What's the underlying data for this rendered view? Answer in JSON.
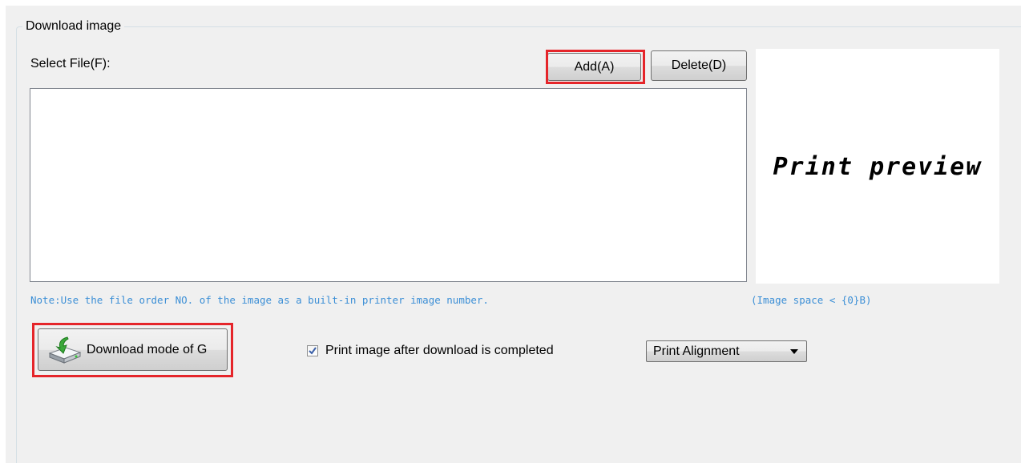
{
  "group": {
    "title": "Download image"
  },
  "file_select": {
    "label": "Select File(F):",
    "add_label": "Add(A)",
    "delete_label": "Delete(D)",
    "items": []
  },
  "preview": {
    "text": "Print preview",
    "image_space": "(Image space < {0}B)"
  },
  "note": "Note:Use the file order NO. of the image as a built-in printer image number.",
  "download": {
    "button_label": "Download mode of G",
    "icon": "download-drive-icon"
  },
  "print_after": {
    "label": "Print image after download is completed",
    "checked": true
  },
  "alignment": {
    "selected": "Print Alignment"
  },
  "colors": {
    "highlight": "#e5252a",
    "note_text": "#3c8fd6",
    "panel_bg": "#f0f0f0"
  }
}
